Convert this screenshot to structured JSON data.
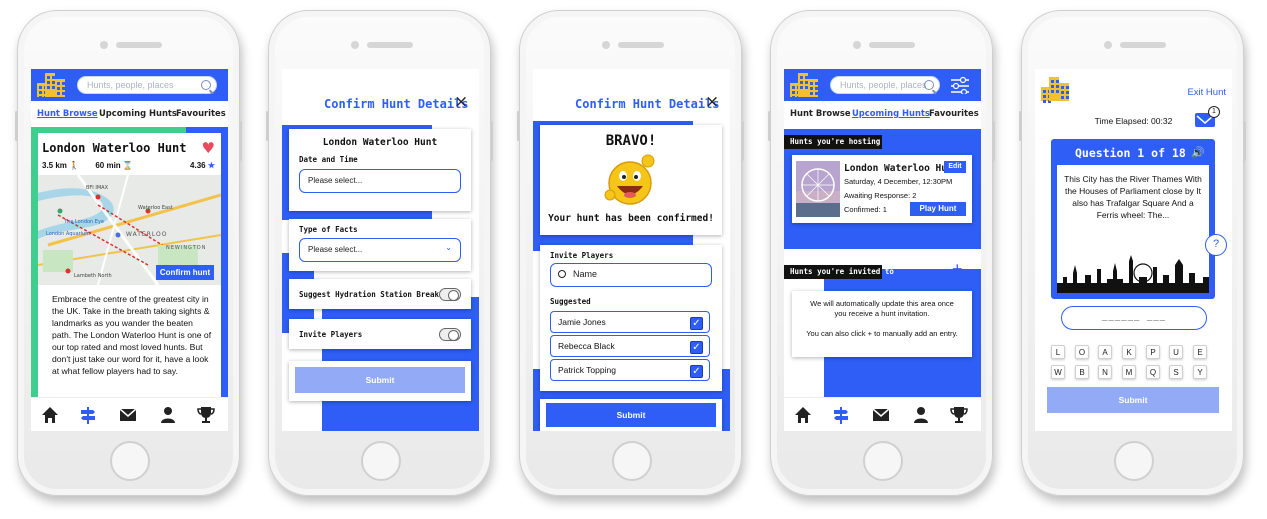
{
  "colors": {
    "accent": "#2e5ef5",
    "submit_disabled": "#93abf7",
    "heart": "#e84a5f",
    "green_strip": "#3ecf8e",
    "logo": "#f2c12e"
  },
  "screen1": {
    "search_placeholder": "Hunts, people, places",
    "tabs": [
      "Hunt Browse",
      "Upcoming Hunts",
      "Favourites"
    ],
    "hunt_title": "London Waterloo Hunt",
    "distance": "3.5 km",
    "duration": "60 min",
    "rating": "4.36",
    "map_button": "Confirm hunt",
    "map_labels": [
      "BFI IMAX",
      "Waterloo East",
      "WATERLOO",
      "NEWINGTON",
      "London Aquarium",
      "The London Eye",
      "Lambeth North"
    ],
    "description": "Embrace the centre of the greatest city in the UK. Take in the breath taking sights & landmarks as you wander the beaten path. The London Waterloo Hunt is one of our top rated and most loved hunts. But don't just take our word for it, have a look at what fellow players had to say."
  },
  "nav_icons": [
    "home-icon",
    "signpost-icon",
    "mail-icon",
    "person-icon",
    "trophy-icon"
  ],
  "screen2": {
    "header_title": "Confirm Hunt Details",
    "close": "×",
    "hunt_name": "London Waterloo Hunt",
    "date_label": "Date and Time",
    "date_placeholder": "Please select...",
    "facts_label": "Type of Facts",
    "facts_placeholder": "Please select...",
    "hydration_label": "Suggest Hydration Station Breaks",
    "invite_label": "Invite Players",
    "submit": "Submit"
  },
  "screen3": {
    "header_title": "Confirm Hunt Details",
    "close": "×",
    "bravo": "BRAVO!",
    "confirmed": "Your hunt has been confirmed!",
    "invite_label": "Invite Players",
    "name_placeholder": "Name",
    "suggested_label": "Suggested",
    "players": [
      "Jamie Jones",
      "Rebecca Black",
      "Patrick Topping"
    ],
    "submit": "Submit"
  },
  "screen4": {
    "search_placeholder": "Hunts, people, places",
    "tabs": [
      "Hunt Browse",
      "Upcoming Hunts",
      "Favourites"
    ],
    "hosting_label": "Hunts you're hosting",
    "hunt_title": "London Waterloo Hunt",
    "edit": "Edit",
    "date": "Saturday, 4 December, 12:30PM",
    "awaiting": "Awaiting Response: 2",
    "confirmed": "Confirmed: 1",
    "play": "Play Hunt",
    "invited_label": "Hunts you're invited to",
    "plus": "+",
    "info1": "We will automatically update this area once you receive a hunt invitation.",
    "info2": "You can also click + to manually add an entry."
  },
  "screen5": {
    "exit": "Exit Hunt",
    "time": "Time Elapsed: 00:32",
    "mail_badge": "1",
    "question_title": "Question 1 of 18",
    "clue": "This City has the River Thames With the Houses of Parliament close by It also has Trafalgar Square And a Ferris wheel: The...",
    "help": "?",
    "answer_mask": "______ ___",
    "keys_row1": [
      "L",
      "O",
      "A",
      "K",
      "P",
      "U",
      "E"
    ],
    "keys_row2": [
      "W",
      "B",
      "N",
      "M",
      "Q",
      "S",
      "Y"
    ],
    "submit": "Submit"
  }
}
